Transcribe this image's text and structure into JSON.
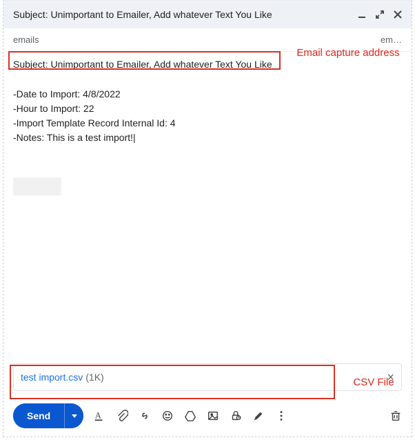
{
  "header": {
    "title": "Subject: Unimportant to Emailer, Add whatever Text You Like"
  },
  "recipients": {
    "label": "emails",
    "truncated_contact": "em…"
  },
  "subject": "Subject: Unimportant to Emailer, Add whatever Text You Like",
  "body": {
    "lines": [
      "-Date to Import: 4/8/2022",
      "-Hour to Import: 22",
      "-Import Template Record Internal Id: 4",
      "-Notes: This is a test import!"
    ]
  },
  "attachment": {
    "name": "test import.csv",
    "size": "(1K)"
  },
  "toolbar": {
    "send_label": "Send"
  },
  "annotations": {
    "recipients": "Email capture address",
    "attachment_label": "CSV File"
  }
}
